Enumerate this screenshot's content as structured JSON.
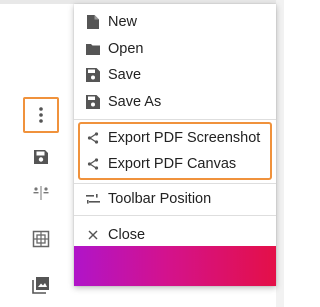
{
  "menu": {
    "items": [
      {
        "label": "New",
        "icon": "file-icon"
      },
      {
        "label": "Open",
        "icon": "folder-icon"
      },
      {
        "label": "Save",
        "icon": "save-icon"
      },
      {
        "label": "Save As",
        "icon": "save-as-icon"
      },
      {
        "label": "Export PDF Screenshot",
        "icon": "share-icon"
      },
      {
        "label": "Export PDF Canvas",
        "icon": "share-icon"
      },
      {
        "label": "Toolbar Position",
        "icon": "toolbar-position-icon"
      },
      {
        "label": "Close",
        "icon": "close-icon"
      }
    ]
  },
  "toolbar": {
    "buttons": [
      "more-vert-icon",
      "save-icon",
      "split-icon",
      "grid-icon",
      "image-icon"
    ]
  },
  "colors": {
    "highlight": "#f0923c",
    "gradient_start": "#b014c9",
    "gradient_end": "#e41048",
    "icon": "#555555"
  }
}
